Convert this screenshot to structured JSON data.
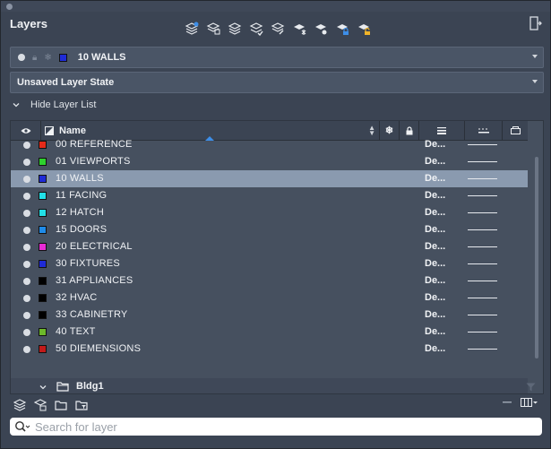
{
  "panel": {
    "title": "Layers"
  },
  "toolbar": {
    "buttons": [
      {
        "icon": "new-layer-icon"
      },
      {
        "icon": "new-layer-vp-frozen-icon"
      },
      {
        "icon": "delete-layer-icon"
      },
      {
        "icon": "set-current-icon"
      },
      {
        "icon": "layer-properties-icon"
      },
      {
        "icon": "freeze-layer-icon"
      },
      {
        "icon": "isolate-layer-icon"
      },
      {
        "icon": "lock-layer-icon"
      },
      {
        "icon": "unlock-layer-icon"
      }
    ]
  },
  "current_layer": {
    "name": "10 WALLS",
    "color": "#1f2bd6"
  },
  "layer_state": {
    "value": "Unsaved Layer State"
  },
  "hide_toggle": {
    "label": "Hide Layer List"
  },
  "columns": {
    "name": "Name"
  },
  "layers": [
    {
      "name": "00 REFERENCE",
      "color": "#e52b1a",
      "lineweight": "De...",
      "selected": false
    },
    {
      "name": "01 VIEWPORTS",
      "color": "#2ed12e",
      "lineweight": "De...",
      "selected": false
    },
    {
      "name": "10 WALLS",
      "color": "#1f2bd6",
      "lineweight": "De...",
      "selected": true
    },
    {
      "name": "11 FACING",
      "color": "#22e0e8",
      "lineweight": "De...",
      "selected": false
    },
    {
      "name": "12 HATCH",
      "color": "#22e0e8",
      "lineweight": "De...",
      "selected": false
    },
    {
      "name": "15 DOORS",
      "color": "#1f8be8",
      "lineweight": "De...",
      "selected": false
    },
    {
      "name": "20 ELECTRICAL",
      "color": "#e82bd6",
      "lineweight": "De...",
      "selected": false
    },
    {
      "name": "30 FIXTURES",
      "color": "#1f2bd6",
      "lineweight": "De...",
      "selected": false
    },
    {
      "name": "31 APPLIANCES",
      "color": "#000000",
      "lineweight": "De...",
      "selected": false
    },
    {
      "name": "32 HVAC",
      "color": "#000000",
      "lineweight": "De...",
      "selected": false
    },
    {
      "name": "33 CABINETRY",
      "color": "#000000",
      "lineweight": "De...",
      "selected": false
    },
    {
      "name": "40 TEXT",
      "color": "#6cb82a",
      "lineweight": "De...",
      "selected": false
    },
    {
      "name": "50 DIEMENSIONS",
      "color": "#c21a1a",
      "lineweight": "De...",
      "selected": false
    }
  ],
  "group": {
    "name": "Bldg1"
  },
  "search": {
    "placeholder": "Search for layer"
  },
  "colors": {
    "panel_bg": "#3b4453",
    "selected_row": "#8a9aaf",
    "accent": "#3d8ee8"
  }
}
